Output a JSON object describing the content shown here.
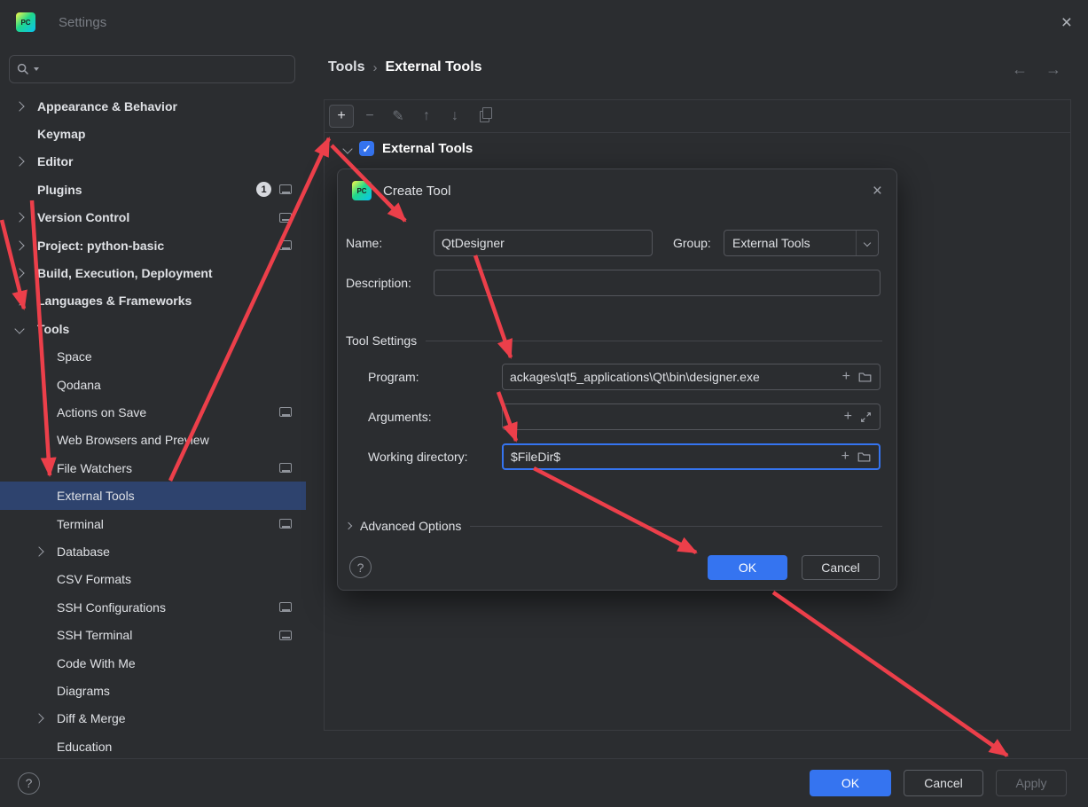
{
  "titlebar": {
    "title": "Settings",
    "logo_text": "PC"
  },
  "icons": {
    "close": "×",
    "help": "?",
    "check": "✓",
    "back_arrow": "←",
    "forward_arrow": "→",
    "breadcrumb_separator": "›",
    "field_plus": "+"
  },
  "sidebar": {
    "search": {
      "value": ""
    },
    "items": [
      {
        "label": "Appearance & Behavior",
        "chevron": "right",
        "level": 0
      },
      {
        "label": "Keymap",
        "level": 0
      },
      {
        "label": "Editor",
        "chevron": "right",
        "level": 0
      },
      {
        "label": "Plugins",
        "level": 0,
        "badge": "1",
        "shared_icon": true
      },
      {
        "label": "Version Control",
        "chevron": "right",
        "level": 0,
        "shared_icon": true
      },
      {
        "label": "Project: python-basic",
        "chevron": "right",
        "level": 0,
        "shared_icon": true
      },
      {
        "label": "Build, Execution, Deployment",
        "chevron": "right",
        "level": 0
      },
      {
        "label": "Languages & Frameworks",
        "chevron": "right",
        "level": 0
      },
      {
        "label": "Tools",
        "chevron": "down",
        "level": 0,
        "expanded": true
      },
      {
        "label": "Space",
        "level": 1
      },
      {
        "label": "Qodana",
        "level": 1
      },
      {
        "label": "Actions on Save",
        "level": 1,
        "shared_icon": true
      },
      {
        "label": "Web Browsers and Preview",
        "level": 1
      },
      {
        "label": "File Watchers",
        "level": 1,
        "shared_icon": true
      },
      {
        "label": "External Tools",
        "level": 1,
        "selected": true
      },
      {
        "label": "Terminal",
        "level": 1,
        "shared_icon": true
      },
      {
        "label": "Database",
        "chevron": "right",
        "level": 1
      },
      {
        "label": "CSV Formats",
        "level": 1
      },
      {
        "label": "SSH Configurations",
        "level": 1,
        "shared_icon": true
      },
      {
        "label": "SSH Terminal",
        "level": 1,
        "shared_icon": true
      },
      {
        "label": "Code With Me",
        "level": 1
      },
      {
        "label": "Diagrams",
        "level": 1
      },
      {
        "label": "Diff & Merge",
        "chevron": "right",
        "level": 1
      },
      {
        "label": "Education",
        "level": 1
      }
    ]
  },
  "content": {
    "breadcrumb": {
      "root": "Tools",
      "current": "External Tools"
    },
    "toolbar": {
      "icons": [
        {
          "name": "add",
          "glyph": "+"
        },
        {
          "name": "remove",
          "glyph": "−"
        },
        {
          "name": "edit",
          "glyph": "✎"
        },
        {
          "name": "move-up",
          "glyph": "↑"
        },
        {
          "name": "move-down",
          "glyph": "↓"
        },
        {
          "name": "copy",
          "glyph": ""
        }
      ]
    },
    "tree": {
      "root_label": "External Tools",
      "checked": true
    }
  },
  "dialog": {
    "title": "Create Tool",
    "sections": {
      "tool_settings": "Tool Settings",
      "advanced_options": "Advanced Options"
    },
    "fields": {
      "name": {
        "label": "Name:",
        "value": "QtDesigner"
      },
      "group": {
        "label": "Group:",
        "value": "External Tools"
      },
      "description": {
        "label": "Description:",
        "value": ""
      },
      "program": {
        "label": "Program:",
        "value": "ackages\\qt5_applications\\Qt\\bin\\designer.exe"
      },
      "arguments": {
        "label": "Arguments:",
        "value": ""
      },
      "working_directory": {
        "label": "Working directory:",
        "value": "$FileDir$"
      }
    },
    "buttons": {
      "ok": "OK",
      "cancel": "Cancel"
    }
  },
  "footer": {
    "ok": "OK",
    "cancel": "Cancel",
    "apply": "Apply"
  },
  "colors": {
    "accent": "#3574f0",
    "selection": "#2e436e",
    "annotation": "#ec3f4a"
  }
}
